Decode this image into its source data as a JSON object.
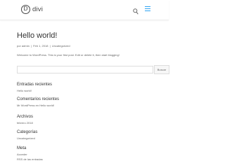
{
  "header": {
    "logo_letter": "D",
    "logo_text": "divi",
    "search_icon": "search-icon",
    "menu_icon": "hamburger-menu-icon",
    "accent_color": "#2ea3f2"
  },
  "post": {
    "title": "Hello world!",
    "meta": {
      "by": "por",
      "author": "admin",
      "date": "Feb 1, 2018",
      "category": "Uncategorized"
    },
    "body": "Welcome to WordPress. This is your first post. Edit or delete it, then start blogging!"
  },
  "search": {
    "value": "",
    "placeholder": "",
    "button_label": "Buscar"
  },
  "widgets": {
    "recent_posts": {
      "title": "Entradas recientes",
      "items": [
        "Hello world!"
      ]
    },
    "recent_comments": {
      "title": "Comentarios recientes",
      "items": [
        "Mr WordPress en Hello world!"
      ]
    },
    "archives": {
      "title": "Archivos",
      "items": [
        "febrero 2018"
      ]
    },
    "categories": {
      "title": "Categorías",
      "items": [
        "Uncategorized"
      ]
    },
    "meta": {
      "title": "Meta",
      "items": [
        "Acceder",
        "RSS de las entradas"
      ]
    }
  }
}
